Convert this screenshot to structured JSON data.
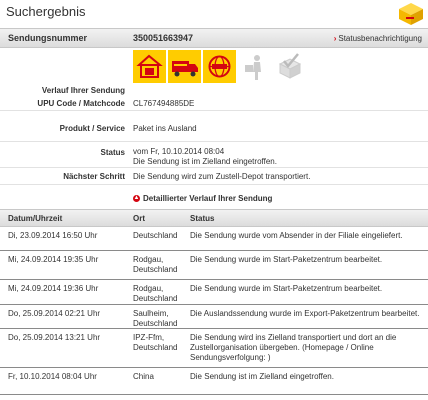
{
  "page": {
    "title": "Suchergebnis"
  },
  "header": {
    "label": "Sendungsnummer",
    "number": "350051663947",
    "notification_link": "Statusbenachrichtigung"
  },
  "info": {
    "verlauf_label": "Verlauf Ihrer Sendung",
    "upu_label": "UPU Code / Matchcode",
    "upu_value": "CL767494885DE",
    "produkt_label": "Produkt / Service",
    "produkt_value": "Paket ins Ausland",
    "status_label": "Status",
    "status_line1": "vom Fr, 10.10.2014 08:04",
    "status_line2": "Die Sendung ist im Zielland eingetroffen.",
    "next_label": "Nächster Schritt",
    "next_value": "Die Sendung wird zum Zustell-Depot transportiert."
  },
  "progress_steps": [
    {
      "icon": "house-box-icon",
      "active": true
    },
    {
      "icon": "truck-icon",
      "active": true
    },
    {
      "icon": "globe-icon",
      "active": true
    },
    {
      "icon": "delivery-person-icon",
      "active": false
    },
    {
      "icon": "checkbox-icon",
      "active": false
    }
  ],
  "detail": {
    "heading": "Detaillierter Verlauf Ihrer Sendung",
    "columns": [
      "Datum/Uhrzeit",
      "Ort",
      "Status"
    ],
    "rows": [
      {
        "date": "Di, 23.09.2014 16:50 Uhr",
        "ort": "Deutschland",
        "status": "Die Sendung wurde vom Absender in der Filiale eingeliefert."
      },
      {
        "date": "Mi, 24.09.2014 19:35 Uhr",
        "ort": "Rodgau, Deutschland",
        "status": "Die Sendung wurde im Start-Paketzentrum bearbeitet."
      },
      {
        "date": "Mi, 24.09.2014 19:36 Uhr",
        "ort": "Rodgau, Deutschland",
        "status": "Die Sendung wurde im Start-Paketzentrum bearbeitet."
      },
      {
        "date": "Do, 25.09.2014 02:21 Uhr",
        "ort": "Saulheim, Deutschland",
        "status": "Die Auslandssendung wurde im Export-Paketzentrum bearbeitet."
      },
      {
        "date": "Do, 25.09.2014 13:21 Uhr",
        "ort": "IPZ-Ffm, Deutschland",
        "status": "Die Sendung wird ins Zielland transportiert und dort an die Zustellorganisation übergeben. (Homepage / Online Sendungsverfolgung: )"
      },
      {
        "date": "Fr, 10.10.2014 08:04 Uhr",
        "ort": "China",
        "status": "Die Sendung ist im Zielland eingetroffen."
      }
    ]
  },
  "colors": {
    "dhl_yellow": "#ffcc00",
    "dhl_red": "#d40511"
  }
}
